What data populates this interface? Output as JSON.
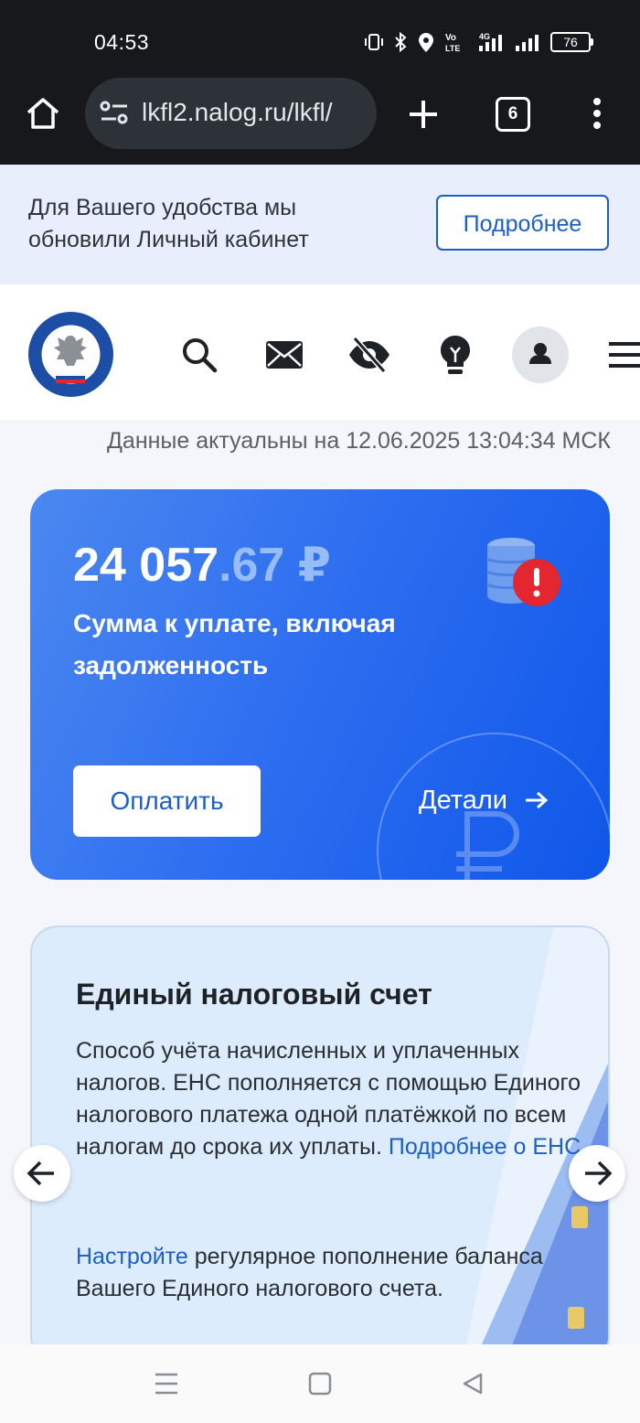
{
  "status_bar": {
    "time": "04:53",
    "battery": "76"
  },
  "browser": {
    "url": "lkfl2.nalog.ru/lkfl/",
    "tab_count": "6"
  },
  "banner": {
    "text": "Для Вашего удобства мы обновили Личный кабинет",
    "button": "Подробнее"
  },
  "updated": "Данные актуальны на 12.06.2025 13:04:34 МСК",
  "balance_card": {
    "amount_main": "24 057",
    "amount_cents": ".67 ₽",
    "label": "Сумма к уплате, включая задолженность",
    "pay_button": "Оплатить",
    "details_link": "Детали"
  },
  "ens_card": {
    "title": "Единый налоговый счет",
    "text": "Способ учёта начисленных и уплаченных налогов. ЕНС пополняется с помощью Единого налогового платежа одной платёжкой по всем налогам до срока их уплаты.",
    "link": "Подробнее о ЕНС",
    "setup_link": "Настройте",
    "setup_text": "регулярное пополнение баланса Вашего Единого налогового счета."
  },
  "colors": {
    "accent": "#1b5fc7",
    "card_blue": "#2f6ff0",
    "alert_red": "#e3262f"
  }
}
